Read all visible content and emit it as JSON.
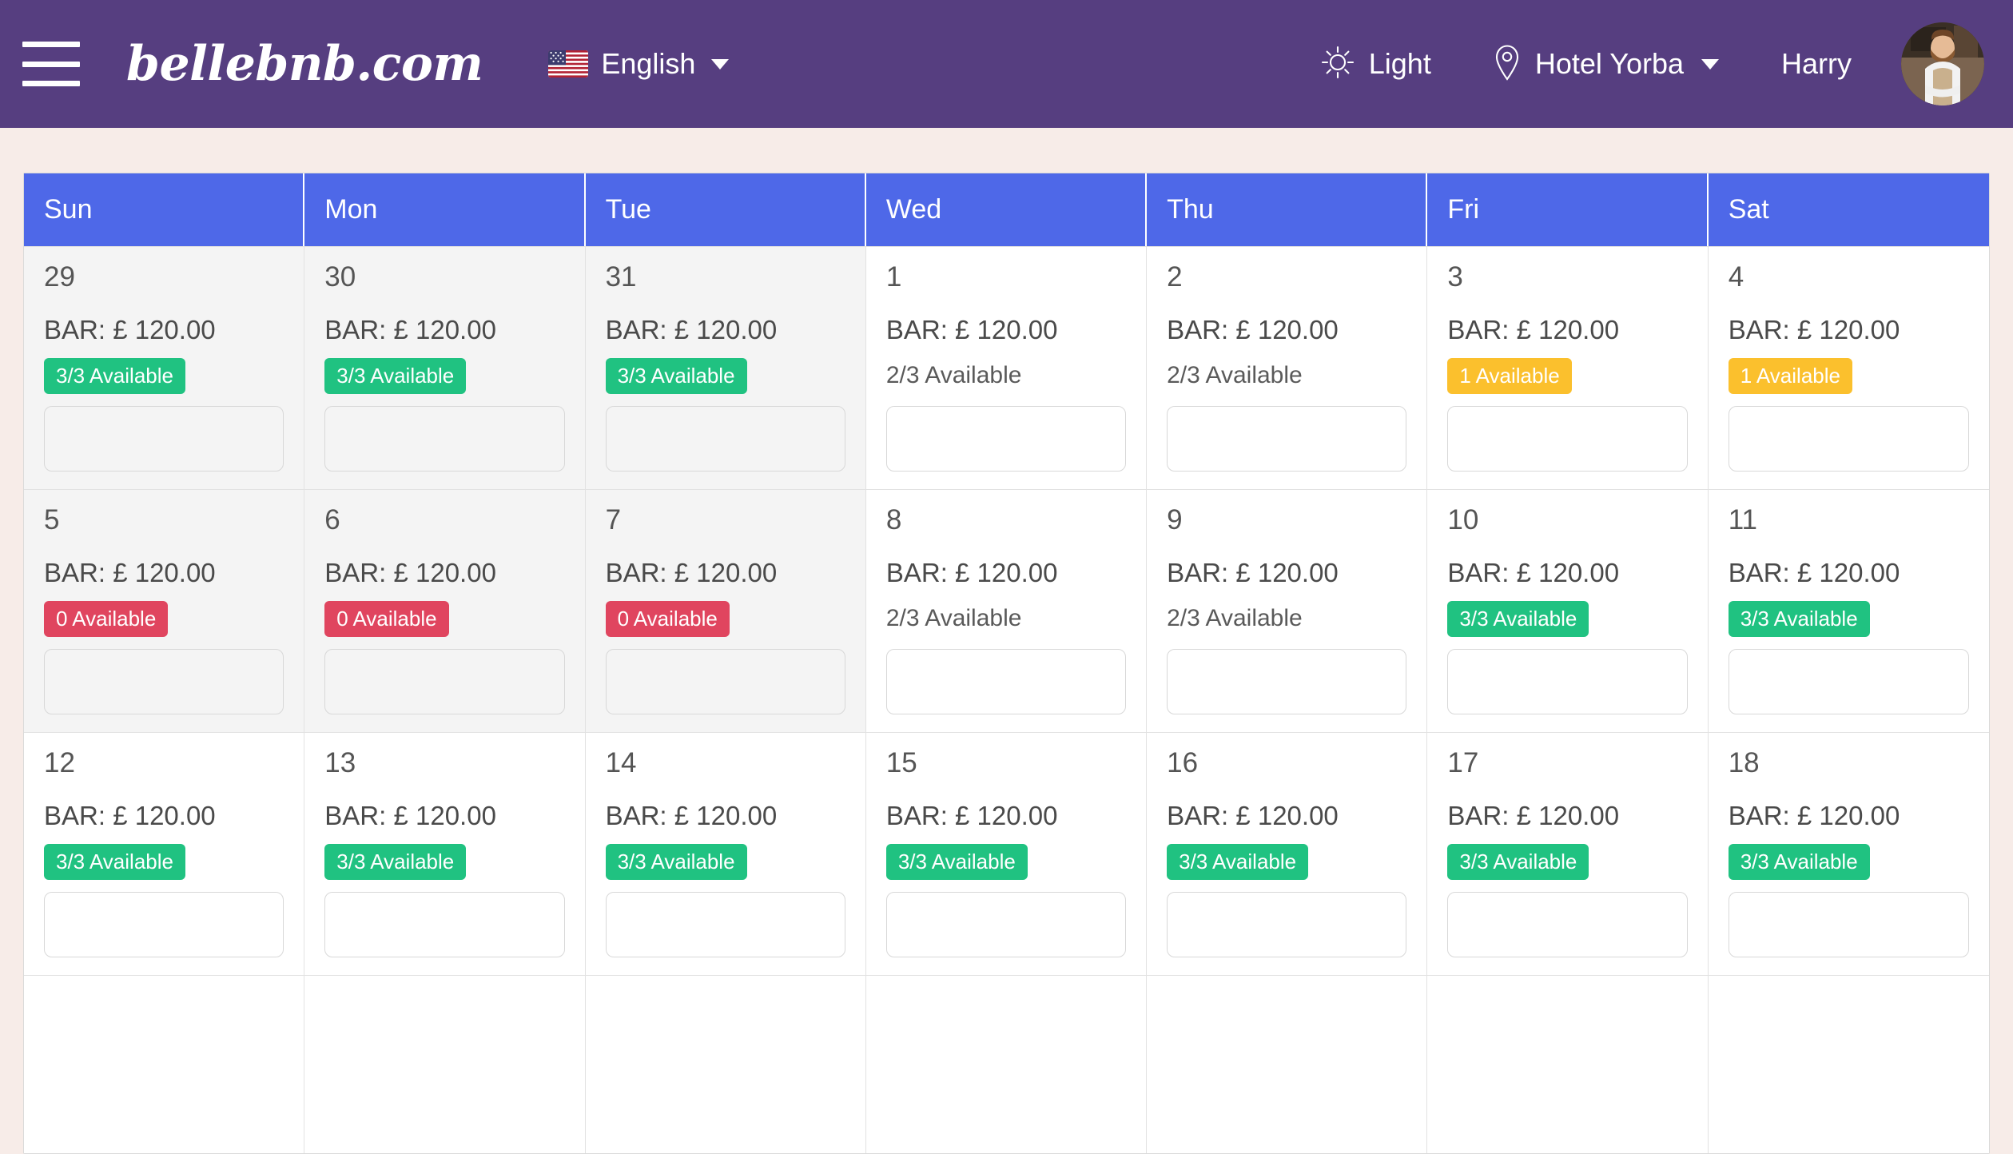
{
  "navbar": {
    "brand": "bellebnb.com",
    "menu_icon": "hamburger-icon",
    "language": {
      "label": "English",
      "flag": "us-flag-icon"
    },
    "theme": {
      "label": "Light",
      "icon": "sun-icon"
    },
    "property": {
      "label": "Hotel Yorba",
      "icon": "location-pin-icon"
    },
    "user": {
      "name": "Harry",
      "avatar": "user-avatar"
    }
  },
  "colors": {
    "navbar_bg": "#563E80",
    "page_bg": "#f7ece8",
    "weekday_header_bg": "#4E68E8",
    "badge_green": "#20C281",
    "badge_yellow": "#FBC02D",
    "badge_red": "#E0455F",
    "muted_cell_bg": "#f4f4f4"
  },
  "calendar": {
    "weekdays": [
      "Sun",
      "Mon",
      "Tue",
      "Wed",
      "Thu",
      "Fri",
      "Sat"
    ],
    "rate_label": "BAR:",
    "currency": "£",
    "weeks": [
      [
        {
          "day": "29",
          "rate": "BAR: £ 120.00",
          "availability": "3/3 Available",
          "style": "green",
          "muted": true
        },
        {
          "day": "30",
          "rate": "BAR: £ 120.00",
          "availability": "3/3 Available",
          "style": "green",
          "muted": true
        },
        {
          "day": "31",
          "rate": "BAR: £ 120.00",
          "availability": "3/3 Available",
          "style": "green",
          "muted": true
        },
        {
          "day": "1",
          "rate": "BAR: £ 120.00",
          "availability": "2/3 Available",
          "style": "plain",
          "muted": false
        },
        {
          "day": "2",
          "rate": "BAR: £ 120.00",
          "availability": "2/3 Available",
          "style": "plain",
          "muted": false
        },
        {
          "day": "3",
          "rate": "BAR: £ 120.00",
          "availability": "1 Available",
          "style": "yellow",
          "muted": false
        },
        {
          "day": "4",
          "rate": "BAR: £ 120.00",
          "availability": "1 Available",
          "style": "yellow",
          "muted": false
        }
      ],
      [
        {
          "day": "5",
          "rate": "BAR: £ 120.00",
          "availability": "0 Available",
          "style": "red",
          "muted": true
        },
        {
          "day": "6",
          "rate": "BAR: £ 120.00",
          "availability": "0 Available",
          "style": "red",
          "muted": true
        },
        {
          "day": "7",
          "rate": "BAR: £ 120.00",
          "availability": "0 Available",
          "style": "red",
          "muted": true
        },
        {
          "day": "8",
          "rate": "BAR: £ 120.00",
          "availability": "2/3 Available",
          "style": "plain",
          "muted": false
        },
        {
          "day": "9",
          "rate": "BAR: £ 120.00",
          "availability": "2/3 Available",
          "style": "plain",
          "muted": false
        },
        {
          "day": "10",
          "rate": "BAR: £ 120.00",
          "availability": "3/3 Available",
          "style": "green",
          "muted": false
        },
        {
          "day": "11",
          "rate": "BAR: £ 120.00",
          "availability": "3/3 Available",
          "style": "green",
          "muted": false
        }
      ],
      [
        {
          "day": "12",
          "rate": "BAR: £ 120.00",
          "availability": "3/3 Available",
          "style": "green",
          "muted": false
        },
        {
          "day": "13",
          "rate": "BAR: £ 120.00",
          "availability": "3/3 Available",
          "style": "green",
          "muted": false
        },
        {
          "day": "14",
          "rate": "BAR: £ 120.00",
          "availability": "3/3 Available",
          "style": "green",
          "muted": false
        },
        {
          "day": "15",
          "rate": "BAR: £ 120.00",
          "availability": "3/3 Available",
          "style": "green",
          "muted": false
        },
        {
          "day": "16",
          "rate": "BAR: £ 120.00",
          "availability": "3/3 Available",
          "style": "green",
          "muted": false
        },
        {
          "day": "17",
          "rate": "BAR: £ 120.00",
          "availability": "3/3 Available",
          "style": "green",
          "muted": false
        },
        {
          "day": "18",
          "rate": "BAR: £ 120.00",
          "availability": "3/3 Available",
          "style": "green",
          "muted": false
        }
      ],
      [
        {
          "day": "",
          "rate": "",
          "availability": "",
          "style": "none",
          "muted": false
        },
        {
          "day": "",
          "rate": "",
          "availability": "",
          "style": "none",
          "muted": false
        },
        {
          "day": "",
          "rate": "",
          "availability": "",
          "style": "none",
          "muted": false
        },
        {
          "day": "",
          "rate": "",
          "availability": "",
          "style": "none",
          "muted": false
        },
        {
          "day": "",
          "rate": "",
          "availability": "",
          "style": "none",
          "muted": false
        },
        {
          "day": "",
          "rate": "",
          "availability": "",
          "style": "none",
          "muted": false
        },
        {
          "day": "",
          "rate": "",
          "availability": "",
          "style": "none",
          "muted": false
        }
      ]
    ]
  }
}
